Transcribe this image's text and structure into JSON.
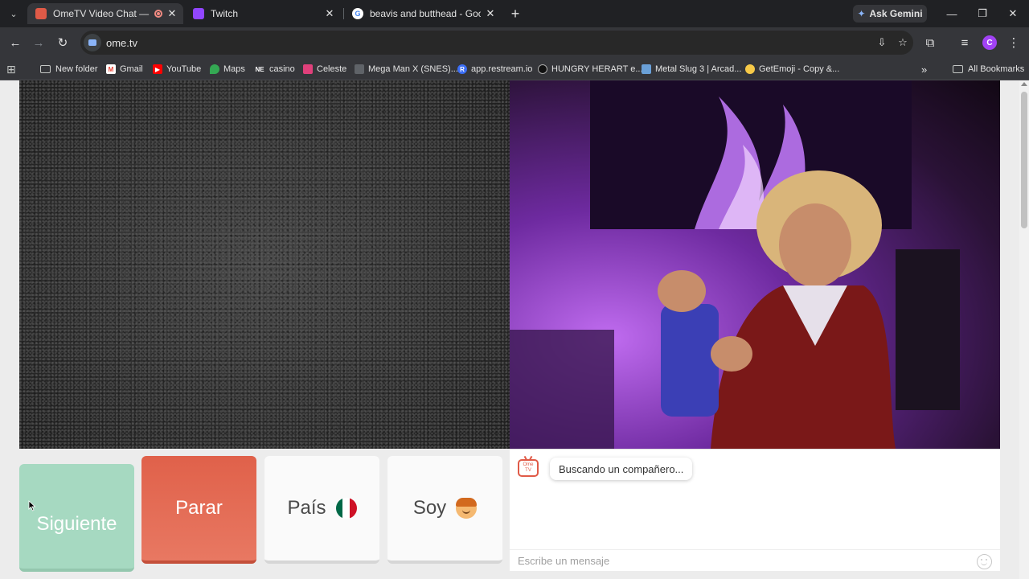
{
  "browser": {
    "tabs": [
      {
        "title": "OmeTV Video Chat — Ome",
        "active": true,
        "favicon": "ometv-icon",
        "recording": true
      },
      {
        "title": "Twitch",
        "active": false,
        "favicon": "twitch-icon"
      },
      {
        "title": "beavis and butthead - Google S",
        "active": false,
        "favicon": "google-icon"
      }
    ],
    "ask_gemini": "Ask Gemini",
    "address": {
      "url": "ome.tv"
    },
    "profile_initial": "C",
    "bookmarks": [
      {
        "label": "New folder",
        "icon": "folder-icon"
      },
      {
        "label": "Gmail",
        "icon": "gmail-icon"
      },
      {
        "label": "YouTube",
        "icon": "youtube-icon"
      },
      {
        "label": "Maps",
        "icon": "maps-icon"
      },
      {
        "label": "casino",
        "icon": "ne-icon",
        "icon_text": "NE"
      },
      {
        "label": "Celeste",
        "icon": "celeste-icon"
      },
      {
        "label": "Mega Man X (SNES)...",
        "icon": "megaman-icon"
      },
      {
        "label": "app.restream.io",
        "icon": "restream-icon",
        "icon_text": "R"
      },
      {
        "label": "HUNGRY HERART e...",
        "icon": "hungry-icon"
      },
      {
        "label": "Metal Slug 3 | Arcad...",
        "icon": "metalslug-icon"
      },
      {
        "label": "GetEmoji - Copy &...",
        "icon": "emoji-icon"
      }
    ],
    "all_bookmarks": "All Bookmarks"
  },
  "ometv": {
    "buttons": {
      "next": "Siguiente",
      "stop": "Parar",
      "country": "País",
      "gender": "Soy"
    },
    "status": "Buscando un compañero...",
    "logo_text": "Ome TV",
    "chat_placeholder": "Escribe un mensaje"
  },
  "colors": {
    "next_button": "#a6d9c1",
    "stop_button": "#e0614a",
    "accent": "#e05a47"
  }
}
